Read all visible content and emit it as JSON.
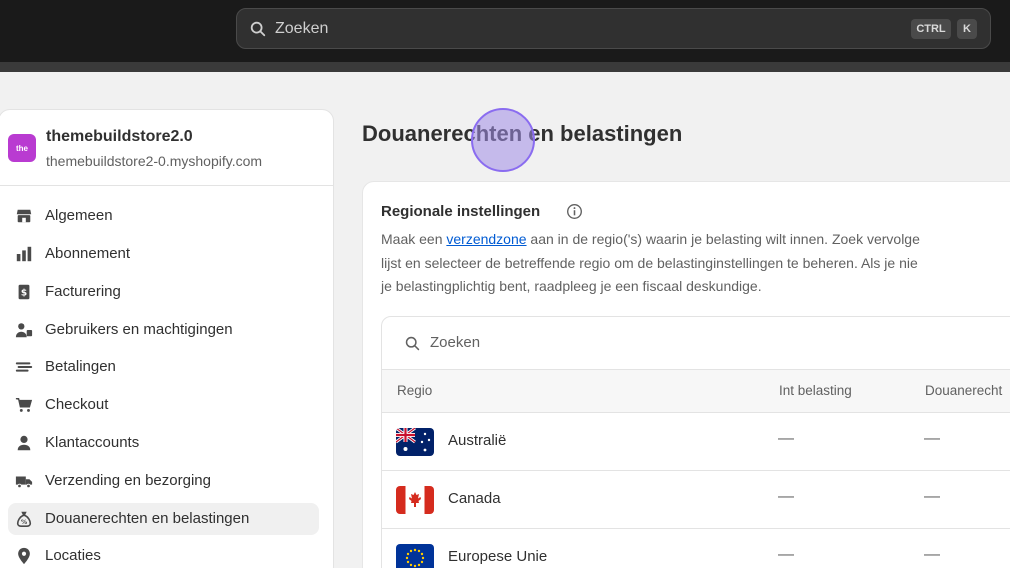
{
  "topbar": {
    "search_placeholder": "Zoeken",
    "shortcut_ctrl": "CTRL",
    "shortcut_k": "K"
  },
  "store": {
    "logo_text": "the",
    "name": "themebuildstore2.0",
    "url": "themebuildstore2-0.myshopify.com"
  },
  "sidebar": {
    "items": [
      {
        "label": "Algemeen",
        "icon": "store-icon"
      },
      {
        "label": "Abonnement",
        "icon": "plan-icon"
      },
      {
        "label": "Facturering",
        "icon": "billing-icon"
      },
      {
        "label": "Gebruikers en machtigingen",
        "icon": "users-icon"
      },
      {
        "label": "Betalingen",
        "icon": "payments-icon"
      },
      {
        "label": "Checkout",
        "icon": "cart-icon"
      },
      {
        "label": "Klantaccounts",
        "icon": "person-icon"
      },
      {
        "label": "Verzending en bezorging",
        "icon": "truck-icon"
      },
      {
        "label": "Douanerechten en belastingen",
        "icon": "tax-bag-icon",
        "active": true
      },
      {
        "label": "Locaties",
        "icon": "location-pin-icon"
      }
    ]
  },
  "main": {
    "page_title": "Douanerechten en belastingen",
    "card": {
      "title": "Regionale instellingen",
      "desc_line1_pre": "Maak een ",
      "desc_link": "verzendzone",
      "desc_line1_post": " aan in de regio('s) waarin je belasting wilt innen. Zoek vervolge",
      "desc_line2": "lijst en selecteer de betreffende regio om de belastinginstellingen te beheren. Als je nie",
      "desc_line3": "je belastingplichtig bent, raadpleeg je een fiscaal deskundige."
    },
    "table": {
      "search_placeholder": "Zoeken",
      "headers": [
        "Regio",
        "Int belasting",
        "Douanerecht"
      ],
      "rows": [
        {
          "region": "Australië",
          "flag": "australia-flag-icon",
          "tax": "—",
          "duties": "—"
        },
        {
          "region": "Canada",
          "flag": "canada-flag-icon",
          "tax": "—",
          "duties": "—"
        },
        {
          "region": "Europese Unie",
          "flag": "eu-flag-icon",
          "tax": "—",
          "duties": "—"
        }
      ]
    }
  },
  "colors": {
    "topbar": "#1a1a1a",
    "canvas": "#f1f1f1",
    "link": "#005bd3",
    "store_logo": "#b93bd1",
    "cursor": "#8a6cf0"
  }
}
